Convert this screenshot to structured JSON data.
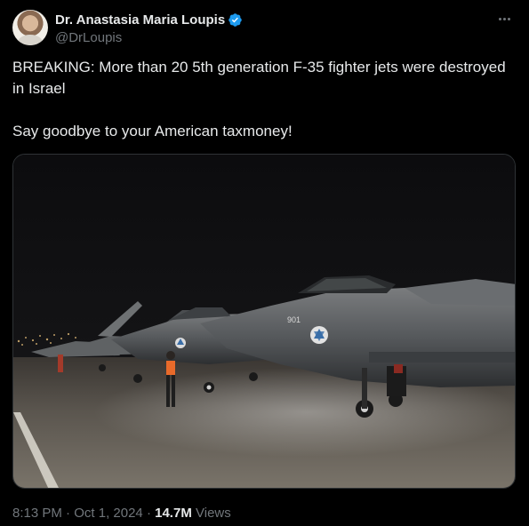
{
  "author": {
    "display_name": "Dr. Anastasia Maria Loupis",
    "handle": "@DrLoupis",
    "verified": true,
    "avatar_icon": "profile-photo"
  },
  "tweet": {
    "line1": "BREAKING: More than 20 5th generation F-35 fighter jets were destroyed in Israel",
    "line2": "Say goodbye to your American taxmoney!"
  },
  "media": {
    "kind": "photo",
    "jet_marking": "901"
  },
  "meta": {
    "time": "8:13 PM",
    "separator": "·",
    "date": "Oct 1, 2024",
    "views_count": "14.7M",
    "views_label": "Views"
  },
  "colors": {
    "background": "#000000",
    "text": "#e7e9ea",
    "muted": "#71767b",
    "verified_blue": "#1d9bf0"
  },
  "icons": {
    "verified": "verified-badge-icon",
    "more": "more-options-icon"
  }
}
